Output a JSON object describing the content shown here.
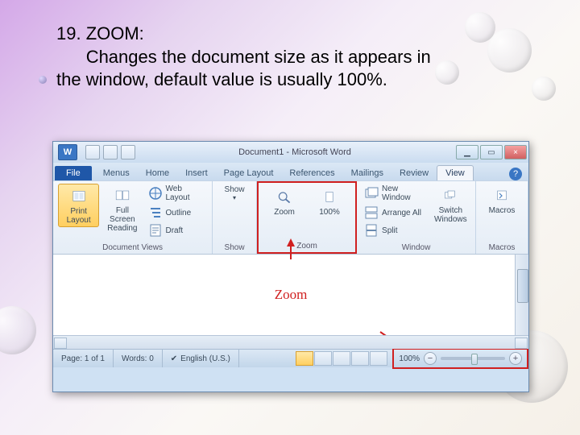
{
  "slide": {
    "heading": "19. ZOOM:",
    "body": "Changes the document size as it appears in the window, default value is usually 100%."
  },
  "word": {
    "logo_letter": "W",
    "title": "Document1 - Microsoft Word",
    "win": {
      "min": "▁",
      "max": "▭",
      "close": "×"
    },
    "help": "?",
    "tabs": {
      "file": "File",
      "items": [
        "Menus",
        "Home",
        "Insert",
        "Page Layout",
        "References",
        "Mailings",
        "Review",
        "View"
      ]
    },
    "ribbon": {
      "document_views": {
        "label": "Document Views",
        "print_layout": "Print Layout",
        "full_screen": "Full Screen Reading",
        "web_layout": "Web Layout",
        "outline": "Outline",
        "draft": "Draft"
      },
      "show": {
        "label": "Show",
        "btn": "Show"
      },
      "zoom": {
        "label": "Zoom",
        "zoom_btn": "Zoom",
        "hundred": "100%"
      },
      "window": {
        "label": "Window",
        "new_window": "New Window",
        "arrange_all": "Arrange All",
        "split": "Split",
        "switch": "Switch Windows"
      },
      "macros": {
        "label": "Macros",
        "btn": "Macros"
      }
    },
    "callout": "Zoom",
    "status": {
      "page": "Page: 1 of 1",
      "words": "Words: 0",
      "lang": "English (U.S.)",
      "zoom_pct": "100%",
      "minus": "−",
      "plus": "+"
    }
  }
}
